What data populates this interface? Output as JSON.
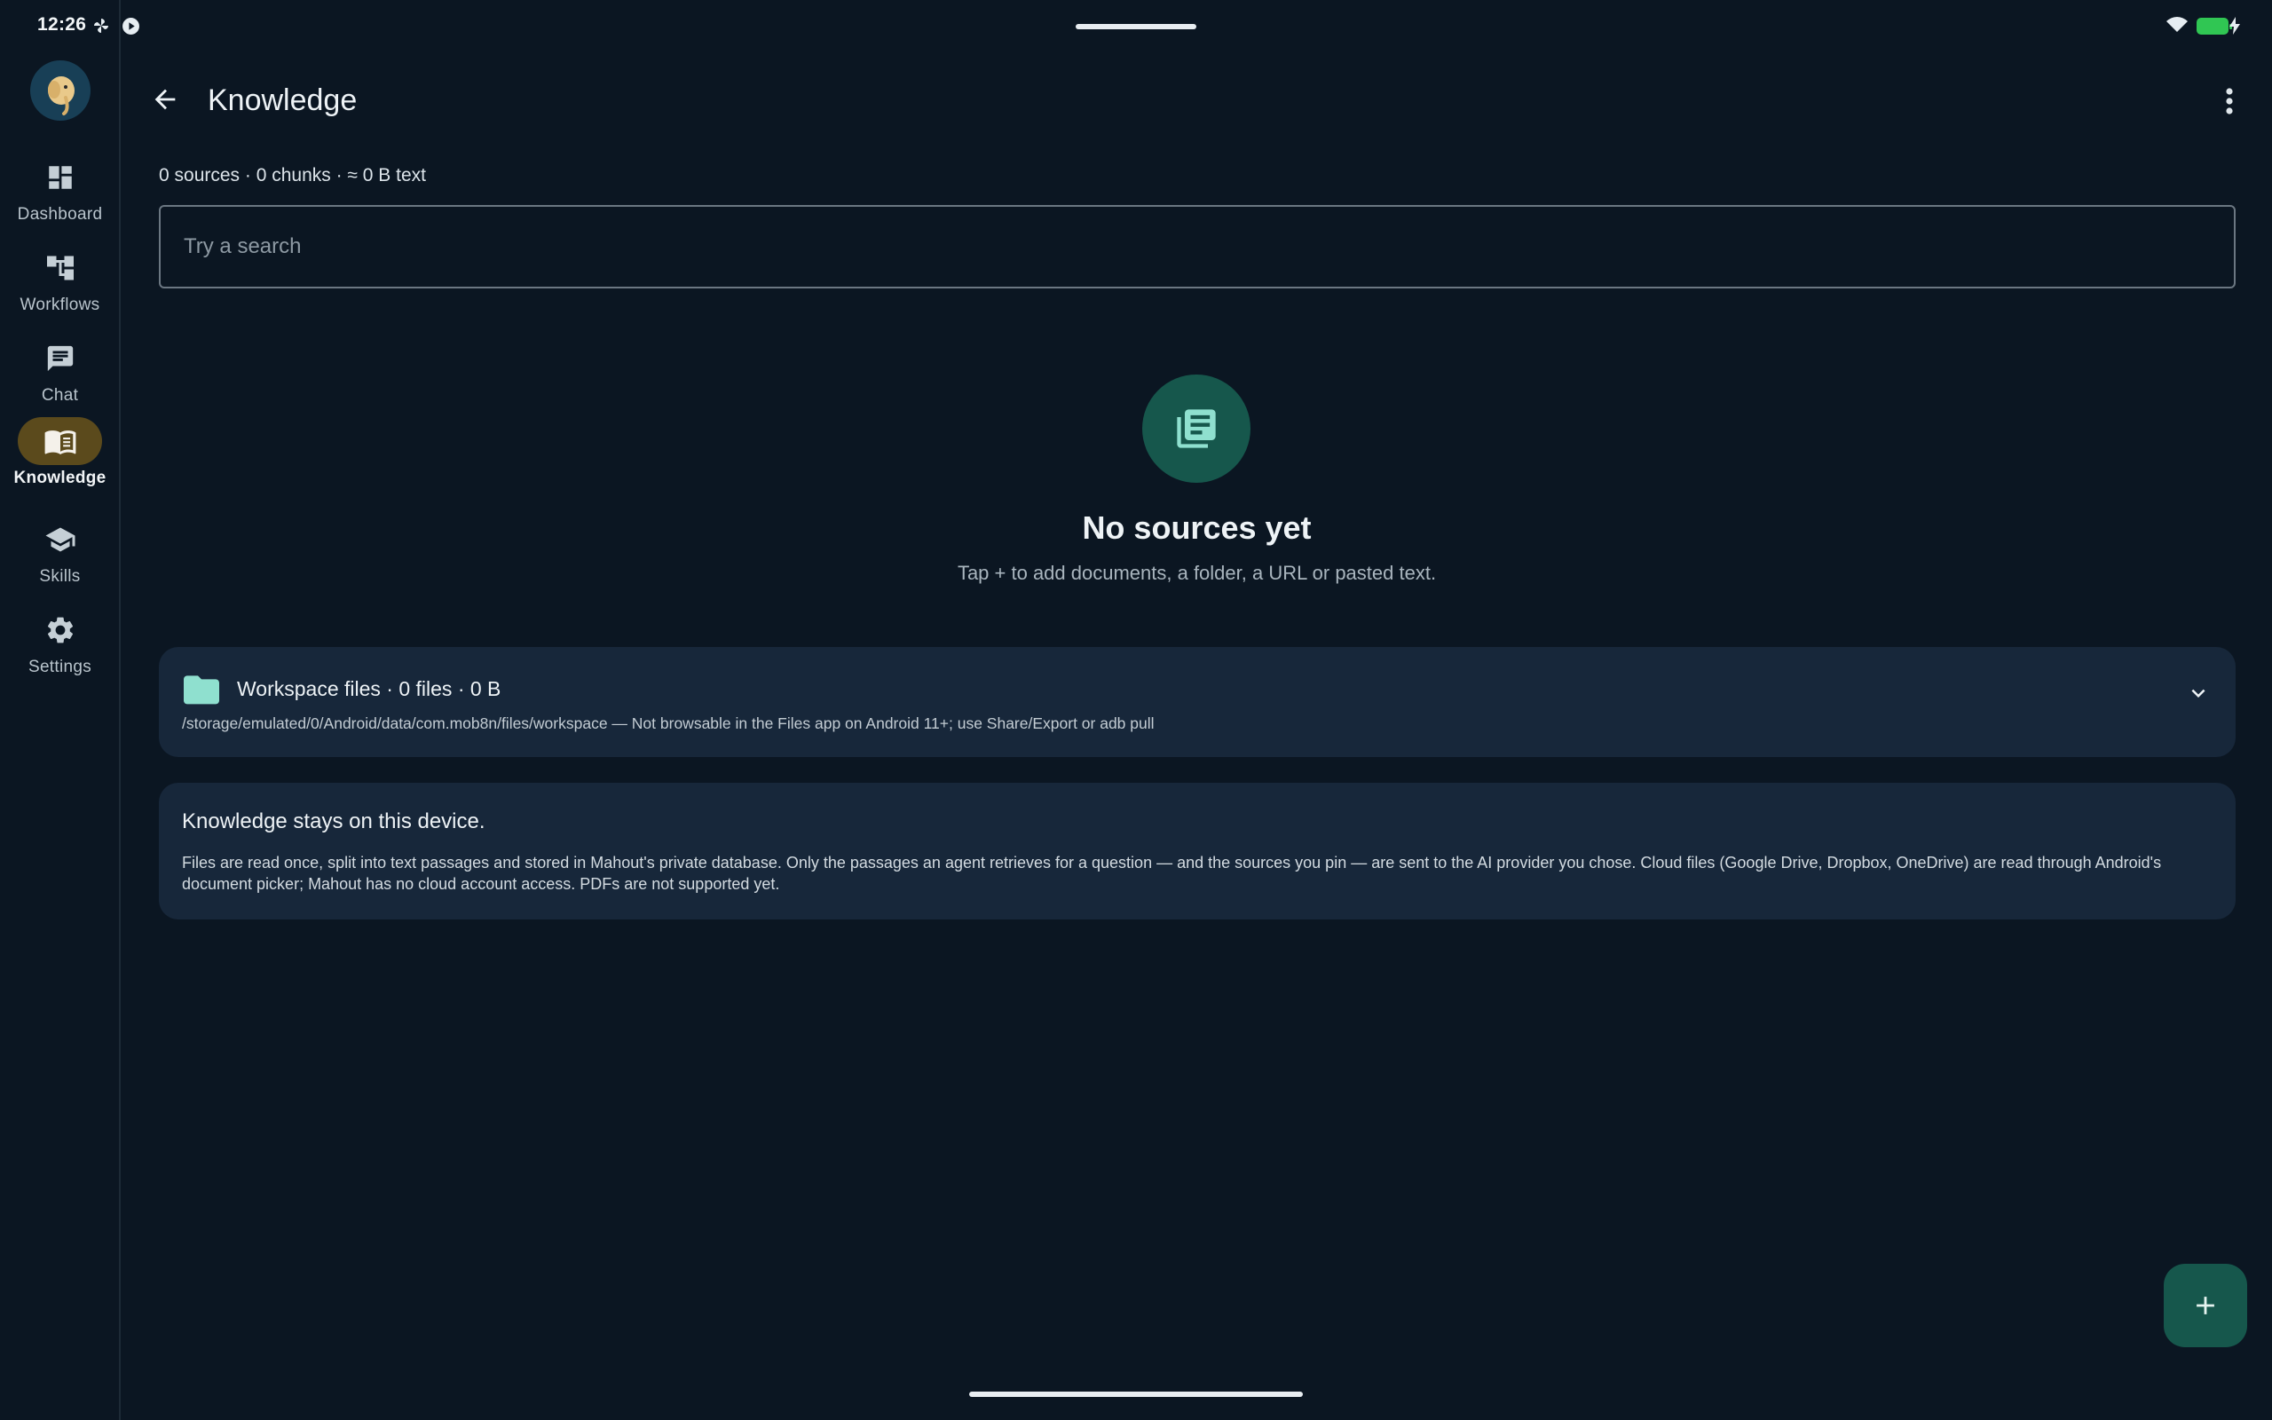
{
  "status_bar": {
    "time": "12:26",
    "icons": [
      "pinwheel-icon",
      "play-circle-icon",
      "wifi-icon",
      "battery-charging-icon"
    ]
  },
  "nav": {
    "items": [
      {
        "label": "Dashboard",
        "icon": "dashboard-icon"
      },
      {
        "label": "Workflows",
        "icon": "workflow-icon"
      },
      {
        "label": "Chat",
        "icon": "chat-icon"
      },
      {
        "label": "Knowledge",
        "icon": "book-icon",
        "active": true
      },
      {
        "label": "Skills",
        "icon": "graduation-cap-icon"
      },
      {
        "label": "Settings",
        "icon": "gear-icon"
      }
    ]
  },
  "header": {
    "title": "Knowledge"
  },
  "stats": "0 sources · 0 chunks · ≈ 0 B text",
  "search": {
    "placeholder": "Try a search",
    "value": ""
  },
  "empty_state": {
    "title": "No sources yet",
    "subtitle": "Tap + to add documents, a folder, a URL or pasted text."
  },
  "workspace": {
    "title": "Workspace files · 0 files · 0 B",
    "path": "/storage/emulated/0/Android/data/com.mob8n/files/workspace — Not browsable in the Files app on Android 11+; use Share/Export or adb pull"
  },
  "privacy": {
    "title": "Knowledge stays on this device.",
    "body": "Files are read once, split into text passages and stored in Mahout's private database. Only the passages an agent retrieves for a question — and the sources you pin — are sent to the AI provider you chose. Cloud files (Google Drive, Dropbox, OneDrive) are read through Android's document picker; Mahout has no cloud account access. PDFs are not supported yet."
  },
  "colors": {
    "background": "#0b1622",
    "card": "#17273a",
    "accent_teal": "#16574c",
    "active_nav": "#5b4a1c",
    "icon_teal": "#8fe0cf"
  }
}
